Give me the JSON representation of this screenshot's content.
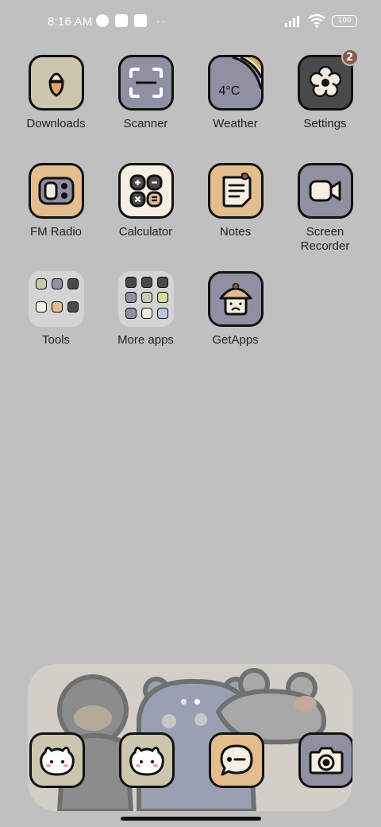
{
  "status": {
    "time": "8:16 AM",
    "battery": "100",
    "dots": "··"
  },
  "apps": {
    "downloads": "Downloads",
    "scanner": "Scanner",
    "weather": "Weather",
    "weather_temp": "4°C",
    "settings": "Settings",
    "settings_badge": "2",
    "fm_radio": "FM Radio",
    "calculator": "Calculator",
    "notes": "Notes",
    "screen_recorder_line1": "Screen",
    "screen_recorder_line2": "Recorder",
    "tools": "Tools",
    "more_apps": "More apps",
    "getapps": "GetApps"
  },
  "colors": {
    "background": "#c0c0c0",
    "tile_beige": "#cbc6ae",
    "tile_gray": "#8f91a2",
    "tile_tan": "#e3bd8e",
    "tile_dark": "#4a4a4a",
    "badge": "#8a5a4a"
  },
  "dock": {
    "icons": [
      "bunny-icon",
      "bunny-icon",
      "message-icon",
      "camera-icon"
    ],
    "pages": 2,
    "active_page": 2
  }
}
